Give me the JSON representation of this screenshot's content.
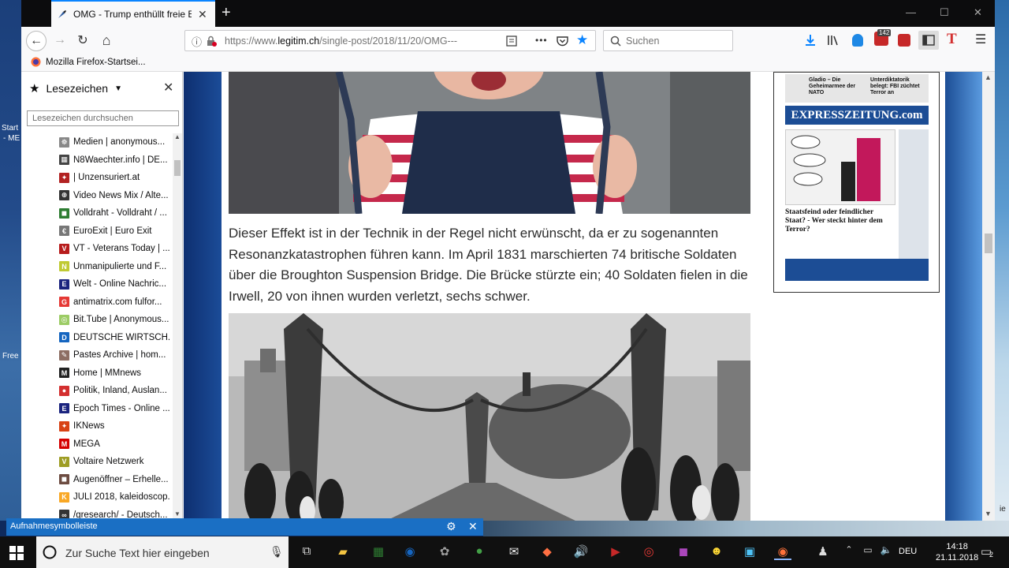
{
  "desktop": {
    "left_labels": [
      "Start",
      "- ME",
      "Free"
    ],
    "right_label": "ie"
  },
  "tab": {
    "title": "OMG - Trump enthüllt freie Ene",
    "close": "✕"
  },
  "window_controls": {
    "minimize": "—",
    "maximize": "☐",
    "close": "✕"
  },
  "nav": {
    "back": "←",
    "forward": "→",
    "reload": "↻",
    "home": "⌂",
    "url_prefix": "https://www.",
    "url_domain": "legitim.ch",
    "url_rest": "/single-post/2018/11/20/OMG---",
    "menu_dots": "•••",
    "search_placeholder": "Suchen",
    "badge_count": "142"
  },
  "bookmarks_toolbar": {
    "item": "Mozilla Firefox-Startsei..."
  },
  "sidebar": {
    "title": "Lesezeichen",
    "close": "✕",
    "search_placeholder": "Lesezeichen durchsuchen",
    "items": [
      {
        "label": "Medien | anonymous...",
        "icon_color": "#888888",
        "glyph": "☸"
      },
      {
        "label": "N8Waechter.info | DE...",
        "icon_color": "#444444",
        "glyph": "▦"
      },
      {
        "label": "| Unzensuriert.at",
        "icon_color": "#b22222",
        "glyph": "✦"
      },
      {
        "label": "Video News Mix / Alte...",
        "icon_color": "#333333",
        "glyph": "⊕"
      },
      {
        "label": "Volldraht - Volldraht / ...",
        "icon_color": "#2e7d32",
        "glyph": "◼"
      },
      {
        "label": "EuroExit | Euro Exit",
        "icon_color": "#777777",
        "glyph": "€"
      },
      {
        "label": "VT - Veterans Today | ...",
        "icon_color": "#b71c1c",
        "glyph": "V"
      },
      {
        "label": "Unmanipulierte und F...",
        "icon_color": "#c0ca33",
        "glyph": "N"
      },
      {
        "label": "Welt - Online Nachric...",
        "icon_color": "#1a237e",
        "glyph": "E"
      },
      {
        "label": "antimatrix.com fulfor...",
        "icon_color": "#e53935",
        "glyph": "G"
      },
      {
        "label": "Bit.Tube | Anonymous...",
        "icon_color": "#9ccc65",
        "glyph": "◎"
      },
      {
        "label": "DEUTSCHE WIRTSCH...",
        "icon_color": "#1565c0",
        "glyph": "D"
      },
      {
        "label": "Pastes Archive | hom...",
        "icon_color": "#8d6e63",
        "glyph": "✎"
      },
      {
        "label": "Home | MMnews",
        "icon_color": "#212121",
        "glyph": "M"
      },
      {
        "label": "Politik, Inland, Auslan...",
        "icon_color": "#d32f2f",
        "glyph": "●"
      },
      {
        "label": "Epoch Times - Online ...",
        "icon_color": "#1a237e",
        "glyph": "E"
      },
      {
        "label": "IKNews",
        "icon_color": "#d84315",
        "glyph": "✦"
      },
      {
        "label": "MEGA",
        "icon_color": "#d50000",
        "glyph": "M"
      },
      {
        "label": "Voltaire Netzwerk",
        "icon_color": "#9e9d24",
        "glyph": "V"
      },
      {
        "label": "Augenöffner – Erhelle...",
        "icon_color": "#6d4c41",
        "glyph": "◼"
      },
      {
        "label": "JULI 2018, kaleidoscop...",
        "icon_color": "#f9a825",
        "glyph": "K"
      },
      {
        "label": "/gresearch/ - Deutsch...",
        "icon_color": "#333333",
        "glyph": "∞"
      }
    ]
  },
  "article": {
    "paragraph": "Dieser Effekt ist in der Technik in der Regel nicht erwünscht, da er zu sogenannten Resonanzkatastrophen führen kann. Im April 1831 marschierten 74 britische Soldaten über die Broughton Suspension Bridge. Die Brücke stürzte ein; 40 Soldaten fielen in die Irwell, 20 von ihnen wurden verletzt, sechs schwer."
  },
  "ad": {
    "masthead": "EXPRESSZEITUNG.com",
    "headline": "Staatsfeind oder feindlicher Staat? - Wer steckt hinter dem Terror?",
    "top_left": "Gladio – Die Geheimarmee der NATO",
    "top_right": "Unterdiktatorik belegt: FBI züchtet Terror an"
  },
  "capture_bar": {
    "label": "Aufnahmesymbolleiste",
    "settings": "⚙",
    "close": "✕"
  },
  "taskbar": {
    "search_placeholder": "Zur Suche Text hier eingeben",
    "language": "DEU",
    "time": "14:18",
    "date": "21.11.2018",
    "notification_count": "2"
  }
}
